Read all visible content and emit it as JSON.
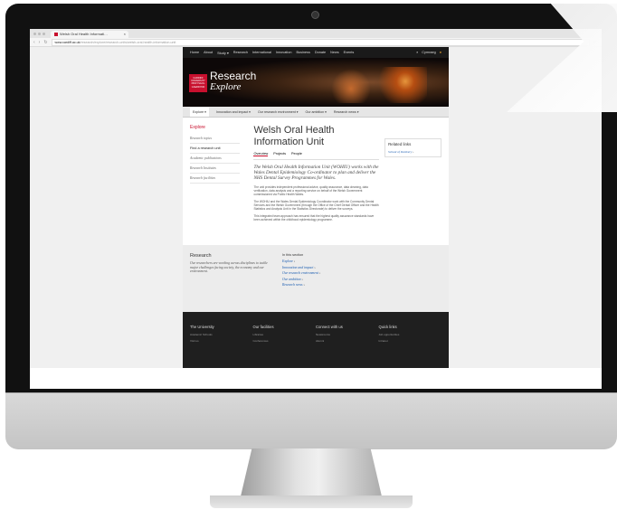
{
  "browser": {
    "tab_title": "Welsh Oral Health Informati…",
    "url_host": "www.cardiff.ac.uk",
    "url_path": "/research/explore/research-units/welsh-oral-health-information-unit"
  },
  "site": {
    "top_nav": [
      "Home",
      "About",
      "Study ▾",
      "Research",
      "International",
      "Innovation",
      "Business",
      "Donate",
      "News",
      "Events"
    ],
    "language": "Cymraeg",
    "logo_text": "CARDIFF UNIVERSITY PRIFYSGOL CAERDYDD",
    "brand_title": "Research",
    "brand_subtitle": "Explore",
    "sub_nav": [
      "Explore ▾",
      "Innovation and impact ▾",
      "Our research environment ▾",
      "Our ambition ▾",
      "Research news ▾"
    ],
    "left_menu": {
      "heading": "Explore",
      "items": [
        "Research topics",
        "Find a research unit",
        "Academic publications",
        "Research Institutes",
        "Research facilities"
      ]
    },
    "page_title": "Welsh Oral Health Information Unit",
    "tabs": [
      "Overview",
      "Projects",
      "People"
    ],
    "lead": "The Welsh Oral Health Information Unit (WOHIU) works with the Wales Dental Epidemiology Co-ordinator to plan and deliver the NHS Dental Survey Programmes for Wales.",
    "paragraphs": [
      "The unit provides independent professional advice, quality assurance, data cleaning, data verification, data analysis and a reporting service on behalf of the Welsh Government commissioned via Public Health Wales.",
      "The WOHIU and the Wales Dental Epidemiology Coordinator work with the Community Dental Services and the Welsh Government (through the Office of the Chief Dental Officer and the Health Statistics and Analysis Unit in the Statistics Directorate) to deliver the surveys.",
      "This integrated team approach has ensured that the highest quality assurance standards have been achieved within the childhood epidemiology programme."
    ],
    "related": {
      "title": "Related links",
      "link": "School of Dentistry"
    },
    "research_block": {
      "title": "Research",
      "desc": "Our researchers are working across disciplines to tackle major challenges facing society, the economy and our environment."
    },
    "in_section": {
      "title": "In this section",
      "links": [
        "Explore",
        "Innovation and impact",
        "Our research environment",
        "Our ambition",
        "Research news"
      ]
    },
    "footer": [
      {
        "title": "The University",
        "items": [
          "Academic Schools",
          "Visit us"
        ]
      },
      {
        "title": "Our facilities",
        "items": [
          "Libraries",
          "Conferences"
        ]
      },
      {
        "title": "Connect with us",
        "items": [
          "Newsrooms",
          "Alumni"
        ]
      },
      {
        "title": "Quick links",
        "items": [
          "Job opportunities",
          "Intranet"
        ]
      }
    ]
  }
}
